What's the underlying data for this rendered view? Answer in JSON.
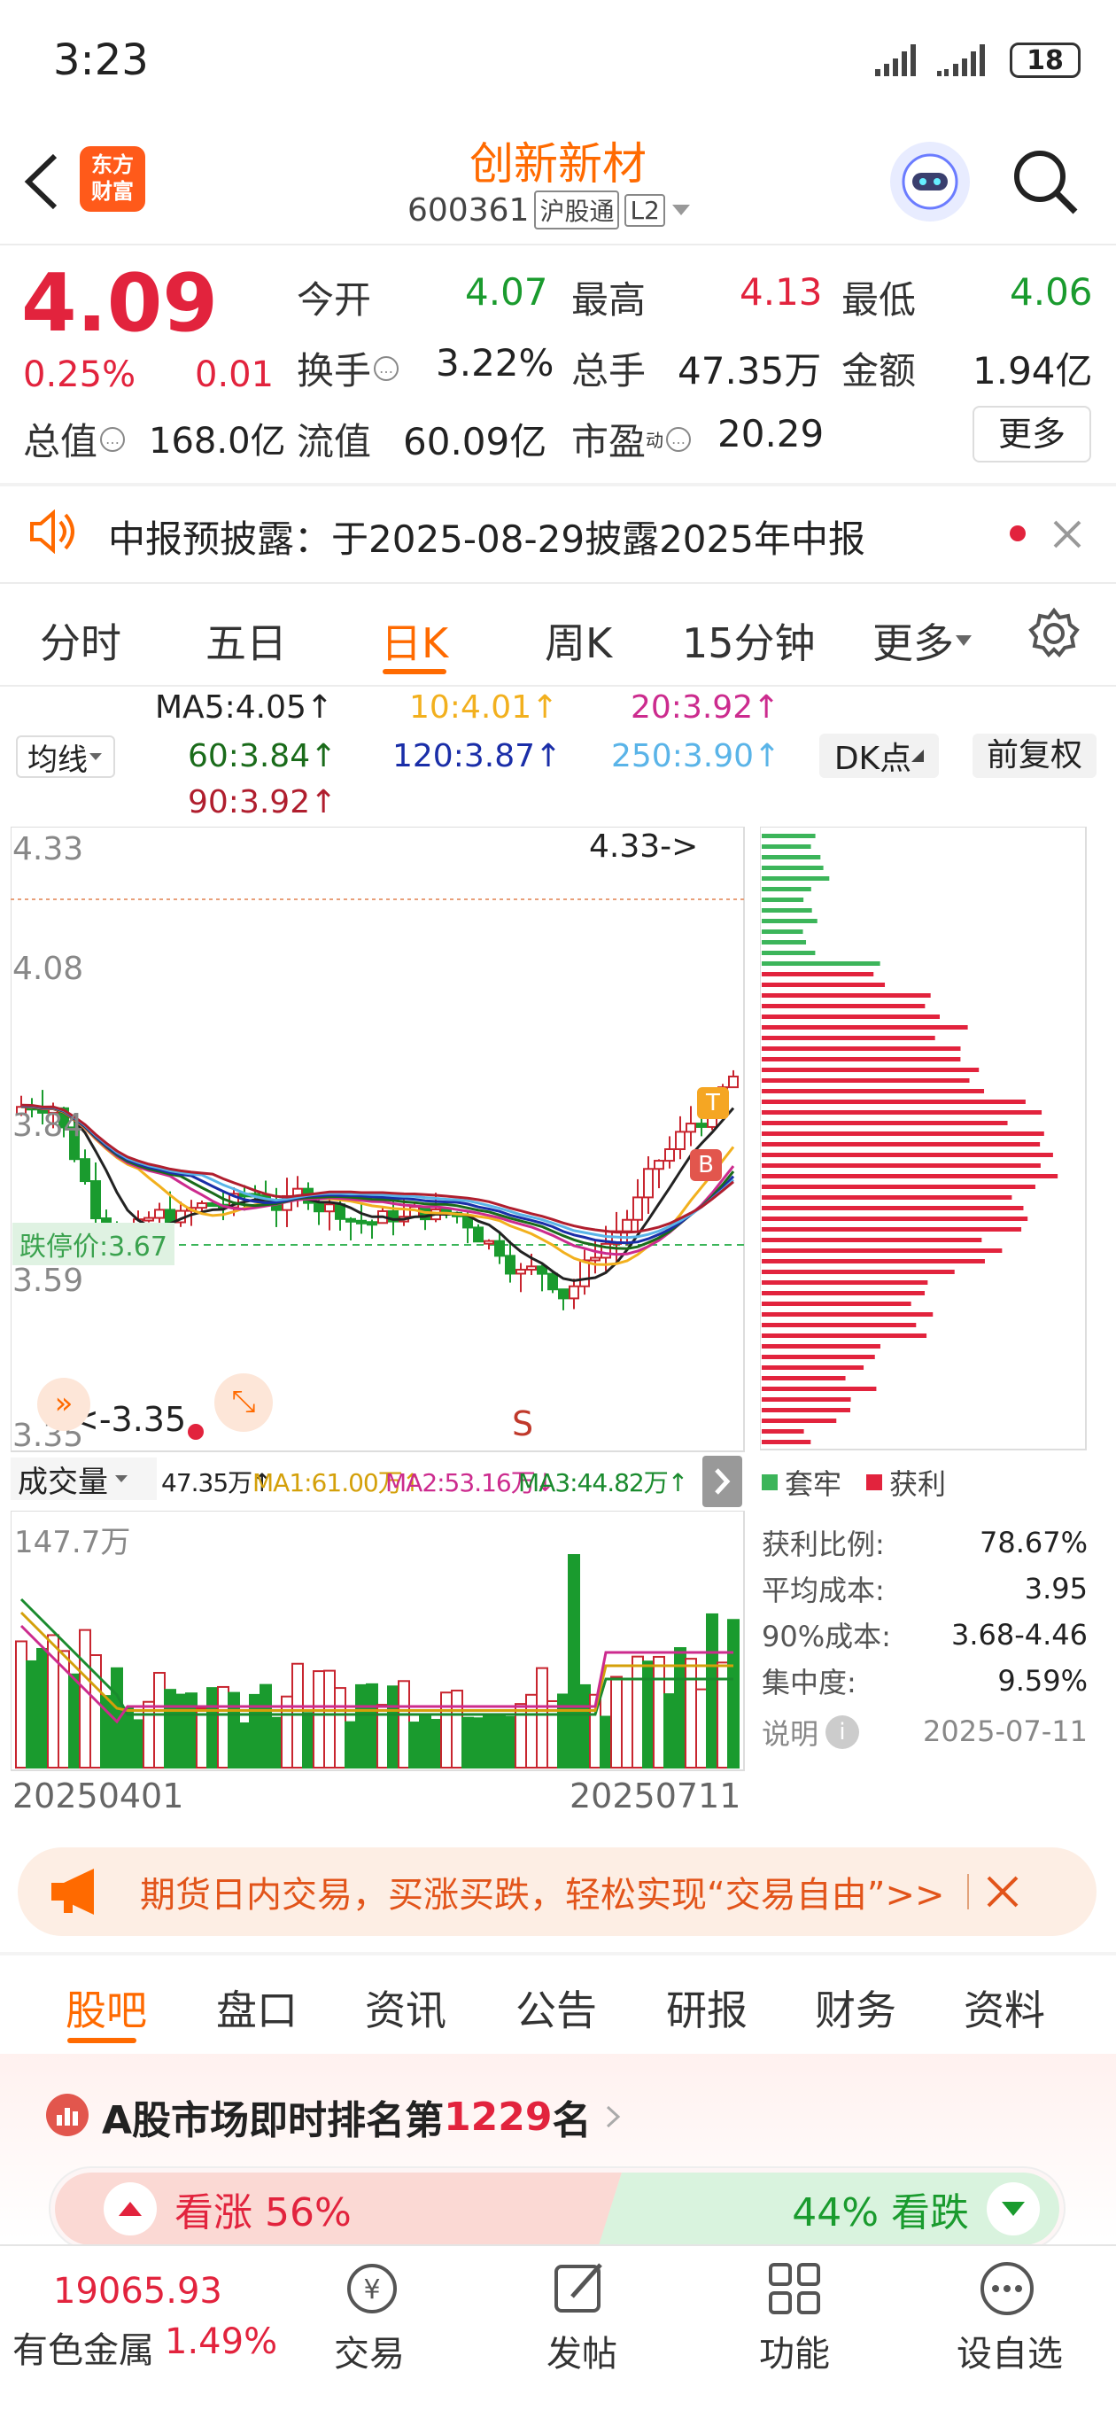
{
  "status": {
    "time": "3:23",
    "battery": "18"
  },
  "header": {
    "title": "创新新材",
    "code": "600361",
    "tag": "沪股通",
    "level": "L2",
    "logo_line1": "东方",
    "logo_line2": "财富"
  },
  "quote": {
    "price": "4.09",
    "pct": "0.25%",
    "chg": "0.01",
    "f": [
      [
        "今开",
        "4.07"
      ],
      [
        "最高",
        "4.13"
      ],
      [
        "最低",
        "4.06"
      ],
      [
        "换手",
        "3.22%"
      ],
      [
        "总手",
        "47.35万"
      ],
      [
        "金额",
        "1.94亿"
      ],
      [
        "总值",
        "168.0亿"
      ],
      [
        "流值",
        "60.09亿"
      ],
      [
        "市盈",
        "20.29"
      ]
    ],
    "dyn": "动",
    "more": "更多"
  },
  "notice": {
    "text": "中报预披露：于2025-08-29披露2025年中报"
  },
  "tabs": [
    "分时",
    "五日",
    "日K",
    "周K",
    "15分钟",
    "更多"
  ],
  "ma": {
    "selector": "均线",
    "ma5": "MA5:4.05↑",
    "ma10": "10:4.01↑",
    "ma20": "20:3.92↑",
    "ma60": "60:3.84↑",
    "ma120": "120:3.87↑",
    "ma250": "250:3.90↑",
    "ma90": "90:3.92↑",
    "dk": "DK点",
    "fq": "前复权"
  },
  "kline": {
    "y_ticks": [
      "4.33",
      "4.08",
      "3.84",
      "3.59",
      "3.35"
    ],
    "high_label": "4.33->",
    "low_label": "<-3.35",
    "limit_down": "跌停价:3.67",
    "s": "S",
    "t": "T",
    "b": "B"
  },
  "volume": {
    "selector": "成交量",
    "vol": "47.35万↑",
    "ma1": "MA1:61.00万↑",
    "ma2": "MA2:53.16万↓",
    "ma3": "MA3:44.82万↑",
    "max": "147.7万",
    "x_start": "20250401",
    "x_end": "20250711"
  },
  "chip": {
    "legend_trap": "套牢",
    "legend_profit": "获利",
    "rows": [
      [
        "获利比例:",
        "78.67%"
      ],
      [
        "平均成本:",
        "3.95"
      ],
      [
        "90%成本:",
        "3.68-4.46"
      ],
      [
        "集中度:",
        "9.59%"
      ]
    ],
    "note": "说明",
    "date": "2025-07-11"
  },
  "ad": {
    "text": "期货日内交易，买涨买跌，轻松实现“交易自由”>>"
  },
  "subtabs": [
    "股吧",
    "盘口",
    "资讯",
    "公告",
    "研报",
    "财务",
    "资料"
  ],
  "rank": {
    "prefix": "A股市场即时排名第",
    "num": "1229",
    "suffix": "名"
  },
  "vote": {
    "up": "看涨 56%",
    "down": "44% 看跌"
  },
  "bottom": {
    "index_value": "19065.93",
    "index_name": "有色金属",
    "index_pct": "1.49%",
    "nav": [
      "交易",
      "发帖",
      "功能",
      "设自选"
    ]
  },
  "colors": {
    "up": "#e2233d",
    "down": "#1a9b2e",
    "accent": "#ff6a00"
  }
}
